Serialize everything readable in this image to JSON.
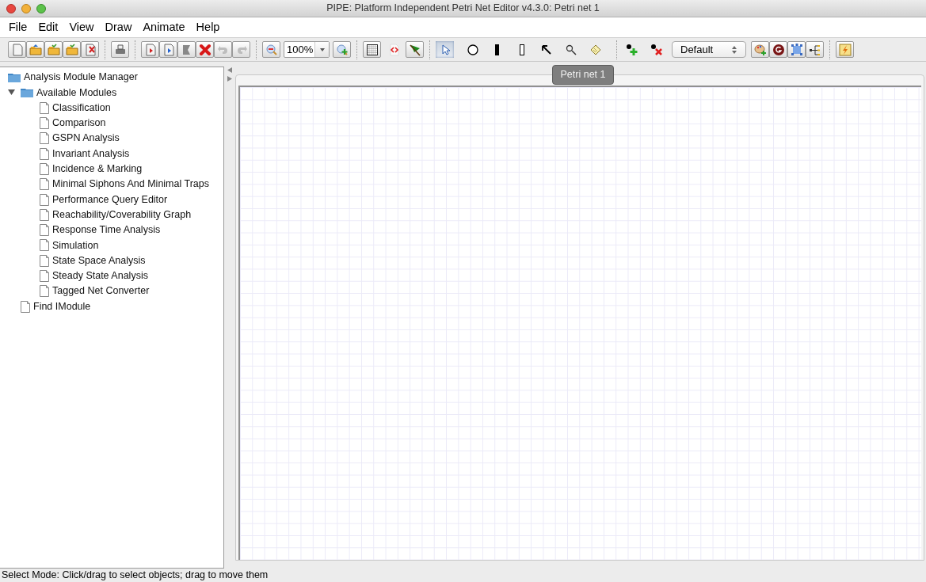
{
  "window": {
    "title": "PIPE: Platform Independent Petri Net Editor v4.3.0: Petri net 1"
  },
  "menu": [
    "File",
    "Edit",
    "View",
    "Draw",
    "Animate",
    "Help"
  ],
  "toolbar": {
    "zoom_value": "100%",
    "style_value": "Default",
    "modes": [
      {
        "selected": true
      },
      {
        "selected": false
      },
      {
        "selected": false
      },
      {
        "selected": false
      },
      {
        "selected": false
      },
      {
        "selected": false
      },
      {
        "selected": false
      }
    ]
  },
  "tree": {
    "label": "Analysis Module Manager",
    "children": [
      {
        "label": "Available Modules",
        "kind": "folder",
        "expanded": true,
        "children": [
          {
            "label": "Classification",
            "kind": "module"
          },
          {
            "label": "Comparison",
            "kind": "module"
          },
          {
            "label": "GSPN Analysis",
            "kind": "module"
          },
          {
            "label": "Invariant Analysis",
            "kind": "module"
          },
          {
            "label": "Incidence & Marking",
            "kind": "module"
          },
          {
            "label": "Minimal Siphons And Minimal Traps",
            "kind": "module"
          },
          {
            "label": "Performance Query Editor",
            "kind": "module"
          },
          {
            "label": "Reachability/Coverability Graph",
            "kind": "module"
          },
          {
            "label": "Response Time Analysis",
            "kind": "module"
          },
          {
            "label": "Simulation",
            "kind": "module"
          },
          {
            "label": "State Space Analysis",
            "kind": "module"
          },
          {
            "label": "Steady State Analysis",
            "kind": "module"
          },
          {
            "label": "Tagged Net Converter",
            "kind": "module"
          }
        ]
      },
      {
        "label": "Find IModule",
        "kind": "module"
      }
    ]
  },
  "tabs": [
    {
      "label": "Petri net 1",
      "selected": true
    }
  ],
  "status_bar": "Select Mode: Click/drag to select objects; drag to move them"
}
